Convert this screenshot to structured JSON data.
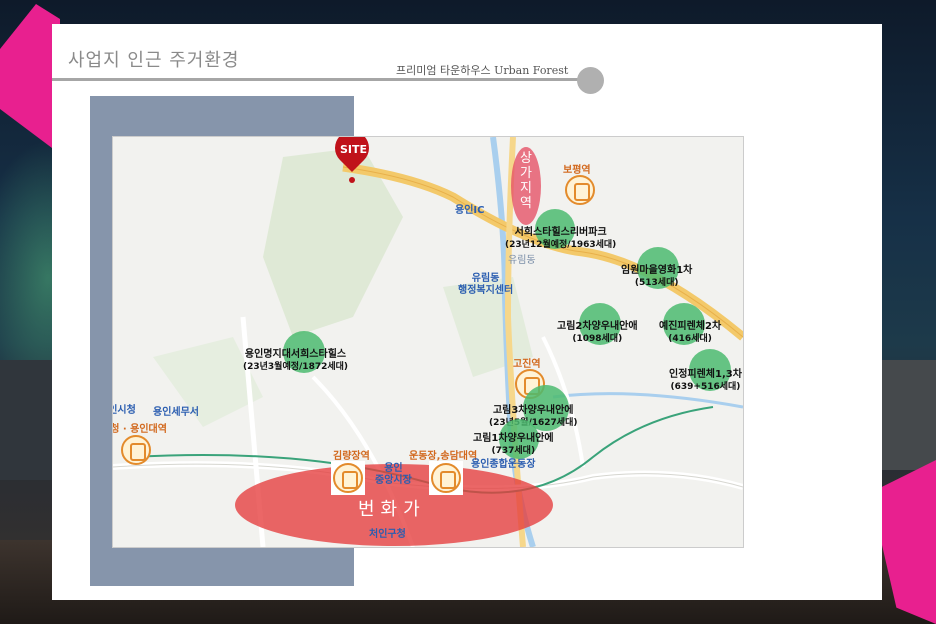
{
  "slide": {
    "title": "사업지 인근 주거환경",
    "subtitle": "프리미엄 타운하우스 Urban Forest"
  },
  "map": {
    "site_label": "SITE",
    "commercial_area": "상가지역",
    "downtown": "번화가",
    "stations": {
      "bojeong": "보평역",
      "gojin": "고진역",
      "gimnyangjang": "김량장역",
      "undongjang": "운동장,송담대역",
      "cityhall_station": "시청 · 용인대역"
    },
    "places": {
      "yongin_ic": "용인IC",
      "yurim_dong": "유림동",
      "yurim_center": "유림동\n행정복지센터",
      "yongin_cityhall": "용인시청",
      "yongin_tax": "용인세무서",
      "market": "용인\n중앙시장",
      "stadium": "용인종합운동장",
      "cheoin_office": "처인구청"
    },
    "complexes": [
      {
        "name": "서희스타힐스리버파크",
        "detail": "(23년12월예정/1963세대)"
      },
      {
        "name": "임원마을영화1차",
        "detail": "(513세대)"
      },
      {
        "name": "고림2차양우내안애",
        "detail": "(1098세대)"
      },
      {
        "name": "예진피렌체2차",
        "detail": "(416세대)"
      },
      {
        "name": "인정피렌체1,3차",
        "detail": "(639+516세대)"
      },
      {
        "name": "용인명지대서희스타힐스",
        "detail": "(23년3월예정/1872세대)"
      },
      {
        "name": "고림3차양우내안에",
        "detail": "(23년5월/1627세대)"
      },
      {
        "name": "고림1차양우내안에",
        "detail": "(737세대)"
      }
    ]
  }
}
